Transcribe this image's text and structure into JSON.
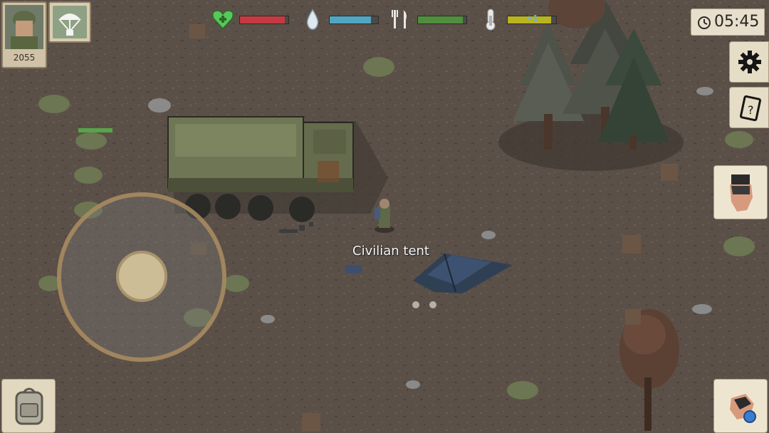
{
  "hud": {
    "player": {
      "xp": "2055"
    },
    "stats": {
      "health": 0.92,
      "thirst": 0.86,
      "hunger": 0.92,
      "temperature": 0.9,
      "temperature_effect": "+1"
    },
    "clock": {
      "time": "05:45"
    }
  },
  "world": {
    "hover_label": "Civilian tent"
  },
  "colors": {
    "health": "#c43a40",
    "thirst": "#4fa6c2",
    "hunger": "#4f8f3c",
    "temperature": "#b9b320",
    "ground": "#5b5048"
  },
  "icons": {
    "health": "heart-plus-icon",
    "thirst": "water-drop-icon",
    "hunger": "fork-knife-icon",
    "temperature": "thermometer-icon",
    "settings": "gear-icon",
    "journal": "notebook-question-icon",
    "interact": "hand-icon",
    "weapon": "fist-icon",
    "inventory": "backpack-icon",
    "airdrop": "parachute-icon"
  }
}
